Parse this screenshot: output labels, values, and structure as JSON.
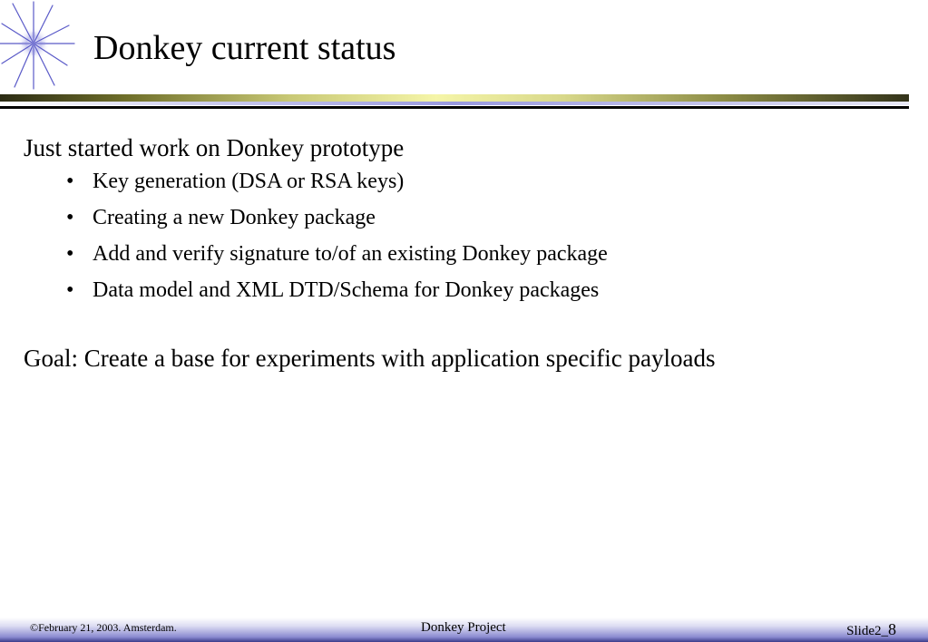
{
  "slide": {
    "title": "Donkey current status",
    "lead": "Just started work on Donkey prototype",
    "bullet_symbol": "•",
    "bullets": [
      "Key generation (DSA or RSA keys)",
      "Creating a new Donkey package",
      "Add and verify signature to/of an existing Donkey package",
      "Data model and XML DTD/Schema for Donkey packages"
    ],
    "goal": "Goal: Create a base for experiments with application specific payloads"
  },
  "footer": {
    "left": "©February 21, 2003. Amsterdam.",
    "center": "Donkey Project",
    "slide_prefix": "Slide2_",
    "slide_number": "8"
  },
  "colors": {
    "star_blue": "#5a5ac8",
    "rule_gold": "#f5f5a8",
    "rule_blue": "#9a9ae0",
    "footer_blue": "#3b3b8a"
  },
  "icons": {
    "logo": "star-burst-icon"
  }
}
